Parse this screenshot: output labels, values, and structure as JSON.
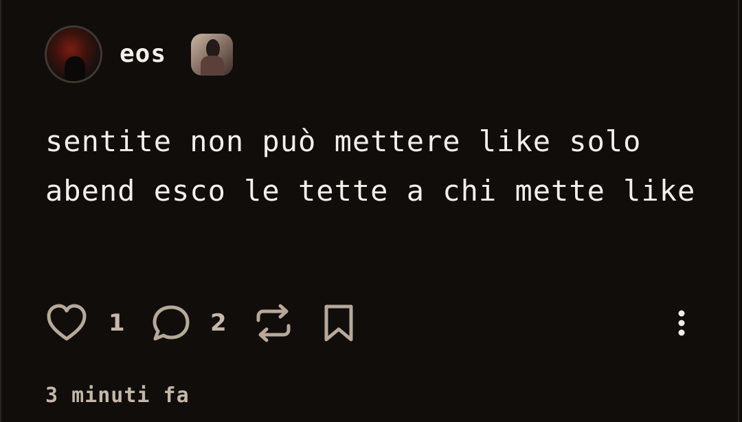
{
  "post": {
    "author": "eos",
    "avatar": "profile-photo-icon",
    "badge": "badge-photo-icon",
    "text": "sentite non può mettere like solo abend esco le tette a chi mette like",
    "timestamp": "3 minuti fa"
  },
  "actions": {
    "like_icon": "heart-icon",
    "like_count": "1",
    "comment_icon": "comment-icon",
    "comment_count": "2",
    "repost_icon": "repost-icon",
    "bookmark_icon": "bookmark-icon",
    "more_icon": "more-vertical-icon"
  },
  "colors": {
    "background": "#110d0b",
    "text": "#f4efe8",
    "muted": "#c4b9ab",
    "icon": "#b6a999"
  }
}
